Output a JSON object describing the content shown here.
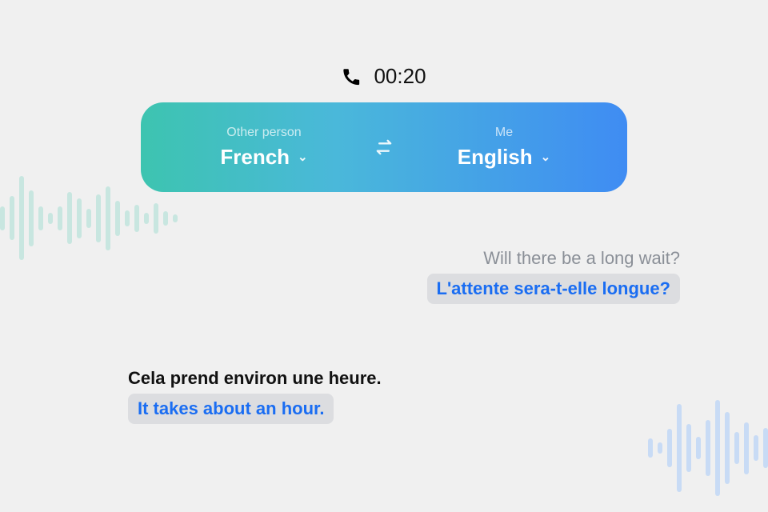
{
  "call": {
    "duration": "00:20"
  },
  "lang_bar": {
    "other": {
      "role_label": "Other person",
      "language": "French"
    },
    "me": {
      "role_label": "Me",
      "language": "English"
    }
  },
  "messages": {
    "right": {
      "original": "Will there be a long wait?",
      "translated": "L'attente sera-t-elle longue?"
    },
    "left": {
      "original": "Cela prend environ une heure.",
      "translated": "It takes about an hour."
    }
  },
  "colors": {
    "accent_blue": "#1a6df2",
    "gradient_start": "#3dc4b0",
    "gradient_end": "#3f8cf3",
    "bubble_bg": "#dcdde0"
  }
}
